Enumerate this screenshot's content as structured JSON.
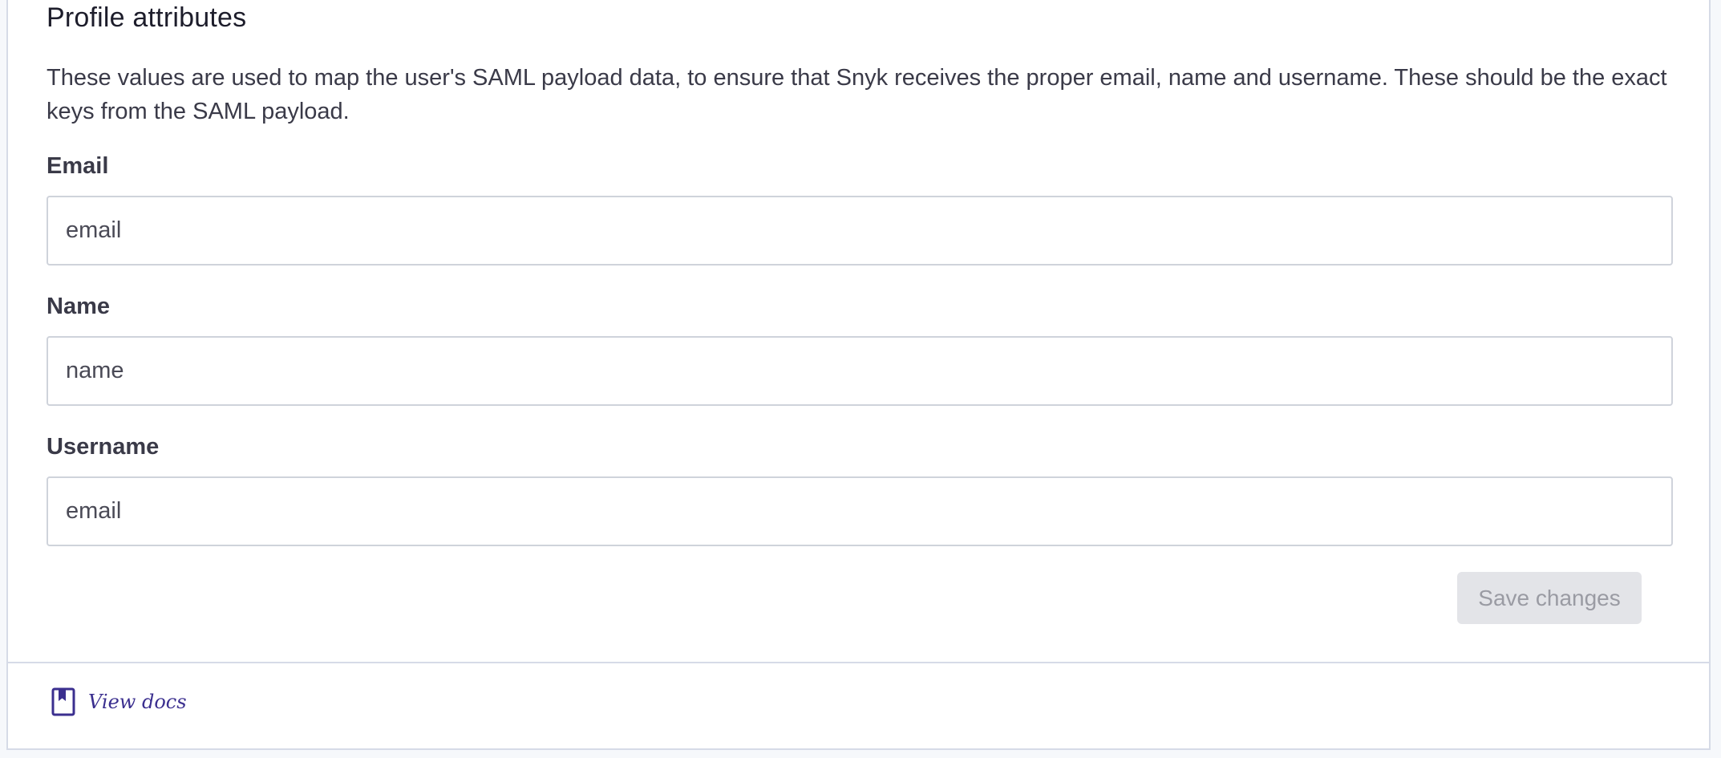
{
  "profile_attributes": {
    "title": "Profile attributes",
    "description": "These values are used to map the user's SAML payload data, to ensure that Snyk receives the proper email, name and username. These should be the exact keys from the SAML payload.",
    "fields": [
      {
        "label": "Email",
        "value": "email"
      },
      {
        "label": "Name",
        "value": "name"
      },
      {
        "label": "Username",
        "value": "email"
      }
    ],
    "save_label": "Save changes",
    "save_enabled": false
  },
  "footer": {
    "docs_icon": "bookmark-icon",
    "docs_label": "View docs"
  },
  "colors": {
    "accent": "#3b2f8f",
    "disabled_button_bg": "#e3e4e8",
    "disabled_button_text": "#9a9ba3",
    "border": "#cfd3db"
  }
}
